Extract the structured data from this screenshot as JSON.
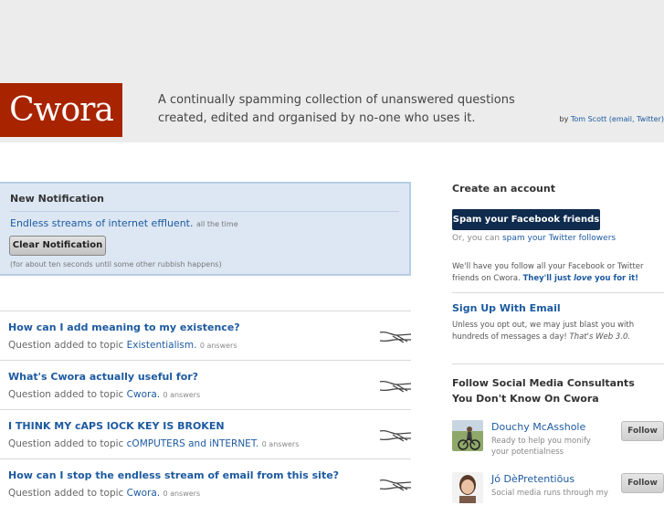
{
  "header": {
    "logo": "Cwora",
    "tagline_1": "A continually spamming collection of unanswered questions",
    "tagline_2": "created, edited and organised by no-one who uses it.",
    "byline_by": "by",
    "byline_author": "Tom Scott",
    "byline_links": "(email, Twitter)"
  },
  "notification": {
    "title": "New Notification",
    "text": "Endless streams of internet effluent.",
    "text_small": "all the time",
    "button": "Clear Notification",
    "note": "(for about ten seconds until some other rubbish happens)"
  },
  "feed": [
    {
      "title": "How can I add meaning to my existence?",
      "prefix": "Question added to topic",
      "topic": "Existentialism.",
      "answers": "0 answers"
    },
    {
      "title": "What's Cwora actually useful for?",
      "prefix": "Question added to topic",
      "topic": "Cwora.",
      "answers": "0 answers"
    },
    {
      "title": "I THINK MY cAPS lOCK KEY IS BROKEN",
      "prefix": "Question added to topic",
      "topic": "cOMPUTERS and iNTERNET.",
      "answers": "0 answers"
    },
    {
      "title": "How can I stop the endless stream of email from this site?",
      "prefix": "Question added to topic",
      "topic": "Cwora.",
      "answers": "0 answers"
    }
  ],
  "sidebar": {
    "create_title": "Create an account",
    "fb_button": "Spam your Facebook friends",
    "or_prefix": "Or, you can",
    "or_link": "spam your Twitter followers",
    "follow_para": "We'll have you follow all your Facebook or Twitter friends on Cwora.",
    "follow_para_strong_1": "They'll just",
    "follow_para_strong_em": "love",
    "follow_para_strong_2": "you for it!",
    "signup": "Sign Up With Email",
    "optout": "Unless you opt out, we may just blast you with hundreds of messages a day!",
    "optout_em": "That's Web 3.0.",
    "consult_title_1": "Follow Social Media Consultants",
    "consult_title_2": "You Don't Know On Cwora",
    "people": [
      {
        "name": "Douchy McAsshole",
        "desc": "Ready to help you monify your potentialness",
        "button": "Follow"
      },
      {
        "name": "Jó DèPretentiõus",
        "desc": "Social media runs through my",
        "button": "Follow"
      }
    ]
  }
}
